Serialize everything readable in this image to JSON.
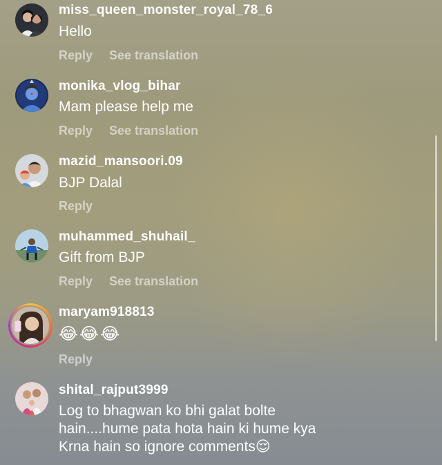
{
  "comments": [
    {
      "username": "miss_queen_monster_royal_78_6",
      "text": "Hello",
      "reply_label": "Reply",
      "translate_label": "See translation"
    },
    {
      "username": "monika_vlog_bihar",
      "text": "Mam please help me",
      "reply_label": "Reply",
      "translate_label": "See translation"
    },
    {
      "username": "mazid_mansoori.09",
      "text": "BJP Dalal",
      "reply_label": "Reply"
    },
    {
      "username": "muhammed_shuhail_",
      "text": "Gift from BJP",
      "reply_label": "Reply",
      "translate_label": "See translation"
    },
    {
      "username": "maryam918813",
      "text": "😂😂😂",
      "reply_label": "Reply"
    },
    {
      "username": "shital_rajput3999",
      "text_lines": [
        "Log to bhagwan ko bhi galat bolte",
        "hain....hume pata hota hain ki hume kya",
        "Krna hain so ignore comments😌"
      ]
    }
  ],
  "avatar_icons": [
    "couple-avatar",
    "shiva-avatar",
    "child-avatar",
    "sports-avatar",
    "selfie-avatar",
    "family-avatar"
  ]
}
